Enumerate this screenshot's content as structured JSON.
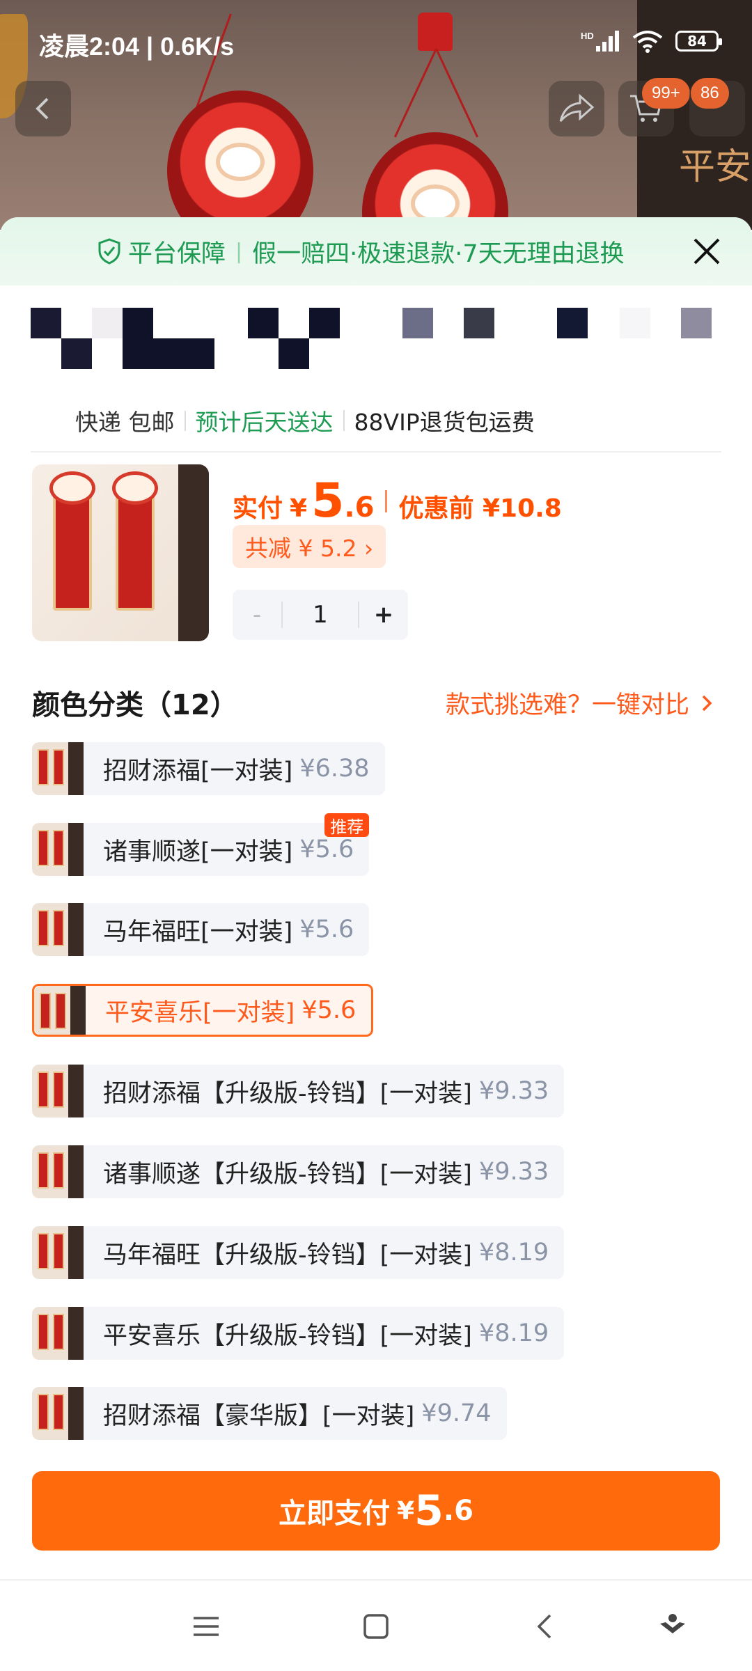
{
  "status_bar": {
    "time": "凌晨2:04 | 0.6K/s",
    "network": "HD",
    "battery": "84"
  },
  "top_nav": {
    "cart_badge": "99+",
    "msg_badge": "86"
  },
  "backdrop": {
    "banner_text": "平安"
  },
  "guarantee": {
    "items": [
      "平台保障",
      "假一赔四·极速退款·7天无理由退换"
    ]
  },
  "shipping": {
    "left": "快递 包邮",
    "eta": "预计后天送达",
    "vip": "88VIP退货包运费"
  },
  "summary": {
    "paid_label": "实付",
    "currency": "¥",
    "paid_int": "5",
    "paid_dec": ".6",
    "original": "优惠前 ¥10.8",
    "discount": "共减 ¥ 5.2 ›",
    "quantity": "1",
    "minus": "-",
    "plus": "+"
  },
  "section": {
    "title": "颜色分类（12）",
    "compare": "款式挑选难？一键对比"
  },
  "variants": [
    {
      "name": "招财添福[一对装]",
      "price": "¥6.38",
      "selected": false
    },
    {
      "name": "诸事顺遂[一对装]",
      "price": "¥5.6",
      "selected": false,
      "badge": "推荐"
    },
    {
      "name": "马年福旺[一对装]",
      "price": "¥5.6",
      "selected": false
    },
    {
      "name": "平安喜乐[一对装]",
      "price": "¥5.6",
      "selected": true
    },
    {
      "name": "招财添福【升级版-铃铛】[一对装]",
      "price": "¥9.33",
      "selected": false
    },
    {
      "name": "诸事顺遂【升级版-铃铛】[一对装]",
      "price": "¥9.33",
      "selected": false
    },
    {
      "name": "马年福旺【升级版-铃铛】[一对装]",
      "price": "¥8.19",
      "selected": false
    },
    {
      "name": "平安喜乐【升级版-铃铛】[一对装]",
      "price": "¥8.19",
      "selected": false
    },
    {
      "name": "招财添福【豪华版】[一对装]",
      "price": "¥9.74",
      "selected": false
    }
  ],
  "pay": {
    "label": "立即支付",
    "currency": "¥",
    "int": "5",
    "dec": ".6"
  },
  "colors": {
    "accent": "#ff6a0d",
    "green": "#1d9b53",
    "chip_bg": "#f3f5f8"
  }
}
